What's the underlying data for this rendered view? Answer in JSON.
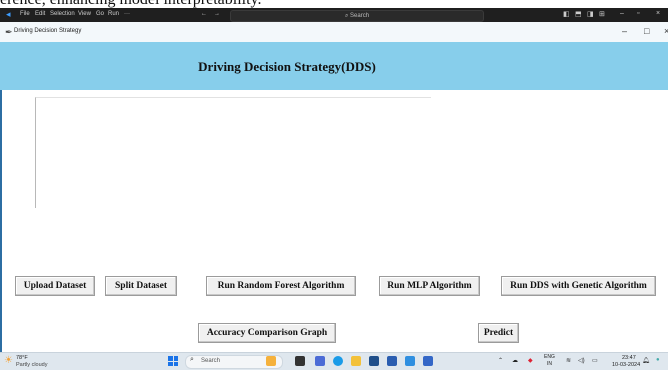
{
  "doc_fragment": "erence, enhancing model interpretability.",
  "vscode": {
    "menu": [
      "File",
      "Edit",
      "Selection",
      "View",
      "Go",
      "Run",
      "···"
    ],
    "search_placeholder": "Search"
  },
  "app_window": {
    "title": "Driving Decision Strategy"
  },
  "header": {
    "title": "Driving Decision Strategy(DDS)",
    "background": "#87ceeb"
  },
  "output": {
    "text": ""
  },
  "buttons": {
    "upload": "Upload Dataset",
    "split": "Split Dataset",
    "random_forest": "Run Random Forest Algorithm",
    "mlp": "Run MLP Algorithm",
    "dds_genetic": "Run DDS with Genetic Algorithm",
    "accuracy_graph": "Accuracy Comparison Graph",
    "predict": "Predict"
  },
  "taskbar": {
    "weather_temp": "78°F",
    "weather_condition": "Partly cloudy",
    "search_placeholder": "Search",
    "lang_top": "ENG",
    "lang_bottom": "IN",
    "time": "23:47",
    "date": "10-03-2024"
  }
}
